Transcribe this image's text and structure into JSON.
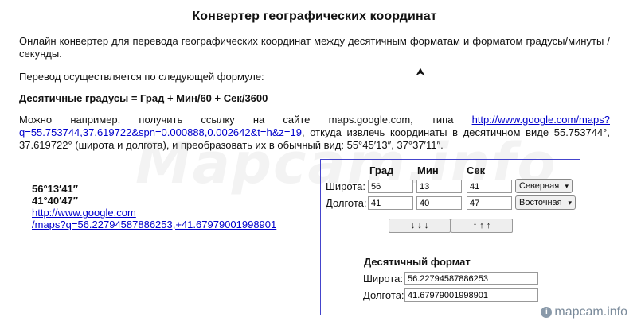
{
  "title": "Конвертер географических координат",
  "intro": "Онлайн конвертер для перевода географических координат между десятичным форматам и форматом градусы/минуты /секунды.",
  "formula_intro": "Перевод осуществляется по следующей формуле:",
  "formula": "Десятичные градусы = Град + Мин/60 + Сек/3600",
  "example": {
    "before": "Можно например, получить ссылку на сайте maps.google.com, типа ",
    "link": "http://www.google.com/maps?q=55.753744,37.619722&spn=0.000888,0.002642&t=h&z=19",
    "after": ", откуда извлечь координаты в десятичном виде 55.753744°, 37.619722° (широта и долгота), и преобразовать их в обычный вид: 55°45′13″, 37°37′11″."
  },
  "result": {
    "lat": "56°13′41″",
    "lon": "41°40′47″",
    "link_line1": "http://www.google.com",
    "link_line2": "/maps?q=56.22794587886253,+41.67979001998901"
  },
  "watermark": "Mapcam.info",
  "converter": {
    "headers": {
      "deg": "Град",
      "min": "Мин",
      "sec": "Сек"
    },
    "lat_label": "Широта:",
    "lon_label": "Долгота:",
    "lat": {
      "deg": "56",
      "min": "13",
      "sec": "41",
      "hemisphere": "Северная"
    },
    "lon": {
      "deg": "41",
      "min": "40",
      "sec": "47",
      "hemisphere": "Восточная"
    },
    "to_decimal_label": "↓ ↓ ↓",
    "to_dms_label": "↑ ↑ ↑",
    "decimal_title": "Десятичный формат",
    "dec_lat_label": "Широта:",
    "dec_lon_label": "Долгота:",
    "dec_lat": "56.22794587886253",
    "dec_lon": "41.67979001998901"
  },
  "logo": {
    "glyph": "i",
    "text": "mapcam.info"
  }
}
